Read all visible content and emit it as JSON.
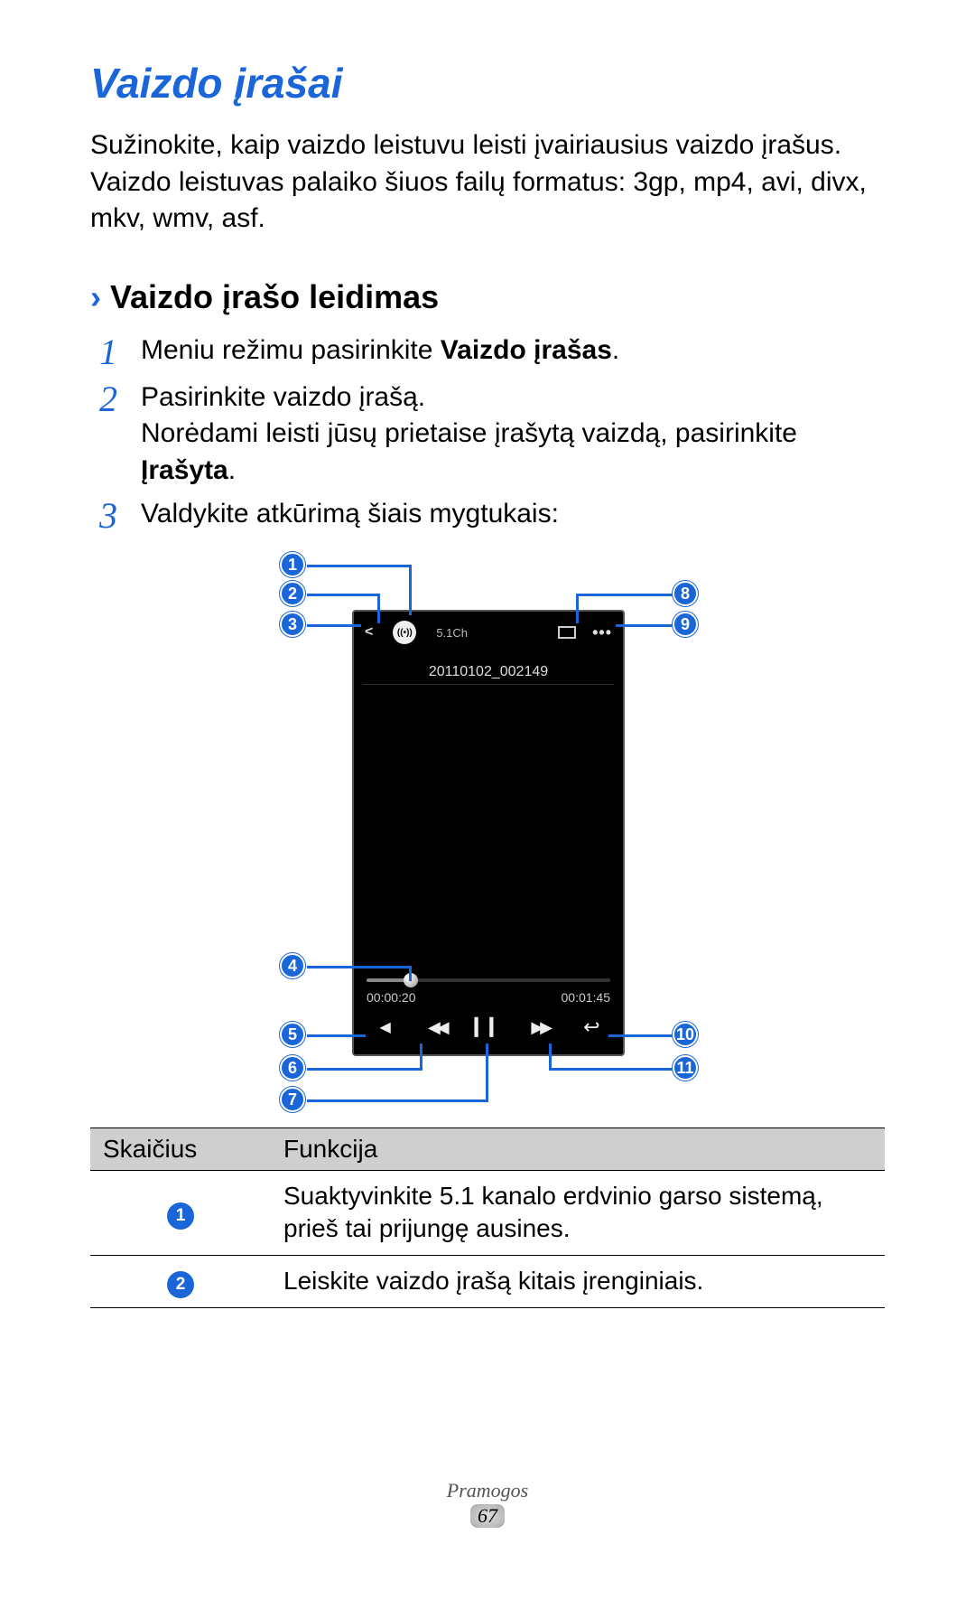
{
  "title": "Vaizdo įrašai",
  "intro": "Sužinokite, kaip vaizdo leistuvu leisti įvairiausius vaizdo įrašus. Vaizdo leistuvas palaiko šiuos failų formatus: 3gp, mp4, avi, divx, mkv, wmv, asf.",
  "sub_arrow": "›",
  "sub_title": "Vaizdo įrašo leidimas",
  "steps": {
    "s1_num": "1",
    "s1_a": "Meniu režimu pasirinkite ",
    "s1_b": "Vaizdo įrašas",
    "s1_c": ".",
    "s2_num": "2",
    "s2_a": "Pasirinkite vaizdo įrašą.",
    "s2_b": "Norėdami leisti jūsų prietaise įrašytą vaizdą, pasirinkite ",
    "s2_c": "Įrašyta",
    "s2_d": ".",
    "s3_num": "3",
    "s3_a": "Valdykite atkūrimą šiais mygtukais:"
  },
  "phone": {
    "btn_51_label": "((•))",
    "btn_51_sub": "5.1Ch",
    "title": "20110102_002149",
    "elapsed": "00:00:20",
    "total": "00:01:45",
    "share": "<",
    "dots": "•••",
    "vol": "◀",
    "prev": "◀◀",
    "pause": "▎▎",
    "next": "▶▶",
    "back": "↩"
  },
  "callouts": {
    "n1": "1",
    "n2": "2",
    "n3": "3",
    "n4": "4",
    "n5": "5",
    "n6": "6",
    "n7": "7",
    "n8": "8",
    "n9": "9",
    "n10": "10",
    "n11": "11"
  },
  "table": {
    "h1": "Skaičius",
    "h2": "Funkcija",
    "r1n": "1",
    "r1t": "Suaktyvinkite 5.1 kanalo erdvinio garso sistemą, prieš tai prijungę ausines.",
    "r2n": "2",
    "r2t": "Leiskite vaizdo įrašą kitais įrenginiais."
  },
  "footer": {
    "category": "Pramogos",
    "page": "67"
  }
}
